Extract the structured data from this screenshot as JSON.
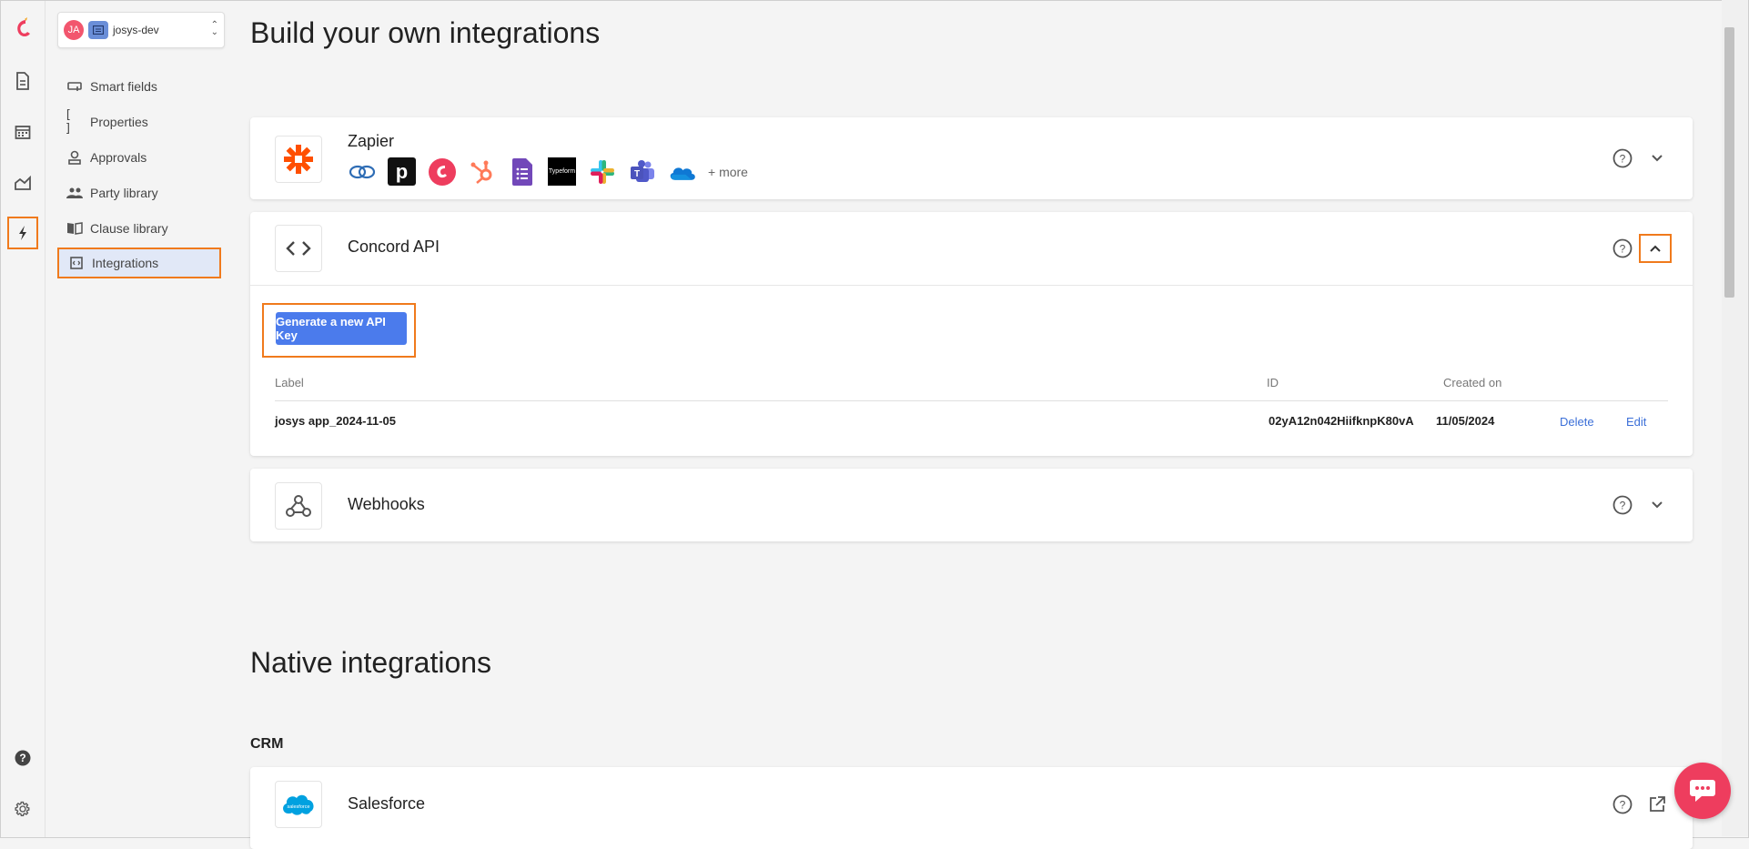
{
  "workspace": {
    "avatar_initials": "JA",
    "name": "josys-dev"
  },
  "nav": {
    "items": [
      {
        "label": "Smart fields",
        "icon": "smart-fields-icon"
      },
      {
        "label": "Properties",
        "icon": "brackets-icon"
      },
      {
        "label": "Approvals",
        "icon": "approvals-icon"
      },
      {
        "label": "Party library",
        "icon": "people-icon"
      },
      {
        "label": "Clause library",
        "icon": "book-icon"
      },
      {
        "label": "Integrations",
        "icon": "integrations-icon"
      }
    ],
    "active": "Integrations"
  },
  "page": {
    "title": "Build your own integrations",
    "native_title": "Native integrations",
    "crm_label": "CRM"
  },
  "zapier": {
    "title": "Zapier",
    "more_label": "+ more",
    "apps": [
      "chain-app-icon",
      "pandadoc-app-icon",
      "concord-app-icon",
      "hubspot-app-icon",
      "google-forms-app-icon",
      "typeform-app-icon",
      "slack-app-icon",
      "teams-app-icon",
      "onedrive-app-icon"
    ],
    "typeform_text": "Typeform"
  },
  "api": {
    "title": "Concord API",
    "generate_button": "Generate a new API Key",
    "columns": {
      "label": "Label",
      "id": "ID",
      "created": "Created on"
    },
    "rows": [
      {
        "label": "josys app_2024-11-05",
        "id": "02yA12n042HiifknpK80vA",
        "created": "11/05/2024",
        "delete": "Delete",
        "edit": "Edit"
      }
    ]
  },
  "webhooks": {
    "title": "Webhooks"
  },
  "salesforce": {
    "title": "Salesforce",
    "logo_text": "salesforce"
  },
  "colors": {
    "accent": "#4b7bec",
    "highlight": "#f07a1c",
    "brand": "#ee3d5e"
  }
}
